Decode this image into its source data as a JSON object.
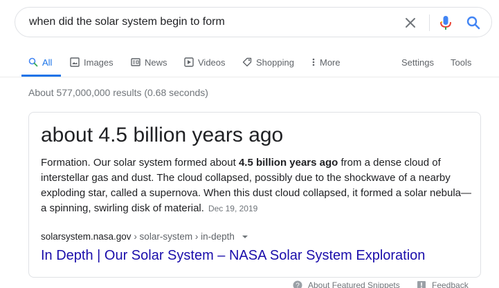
{
  "search": {
    "query": "when did the solar system begin to form"
  },
  "tabs": [
    {
      "label": "All",
      "icon": "search-icon",
      "active": true
    },
    {
      "label": "Images",
      "icon": "image-icon"
    },
    {
      "label": "News",
      "icon": "news-icon"
    },
    {
      "label": "Videos",
      "icon": "video-icon"
    },
    {
      "label": "Shopping",
      "icon": "tag-icon"
    },
    {
      "label": "More",
      "icon": "more-vert-icon"
    }
  ],
  "tools": {
    "settings_label": "Settings",
    "tools_label": "Tools"
  },
  "result_stats": "About 577,000,000 results (0.68 seconds)",
  "featured_snippet": {
    "answer": "about 4.5 billion years ago",
    "text_before": "Formation. Our solar system formed about ",
    "text_bold": "4.5 billion years ago",
    "text_after": " from a dense cloud of interstellar gas and dust. The cloud collapsed, possibly due to the shockwave of a nearby exploding star, called a supernova. When this dust cloud collapsed, it formed a solar nebula—a spinning, swirling disk of material.",
    "date": "Dec 19, 2019",
    "breadcrumb_domain": "solarsystem.nasa.gov",
    "breadcrumb_path": " › solar-system › in-depth",
    "link_title": "In Depth | Our Solar System – NASA Solar System Exploration"
  },
  "footer": {
    "about_label": "About Featured Snippets",
    "feedback_label": "Feedback"
  },
  "colors": {
    "accent": "#1a73e8",
    "link": "#1a0dab",
    "muted": "#70757a",
    "mic_blue": "#4285f4",
    "mic_red": "#ea4335",
    "mic_green": "#34a853",
    "mic_yellow": "#fbbc04"
  }
}
